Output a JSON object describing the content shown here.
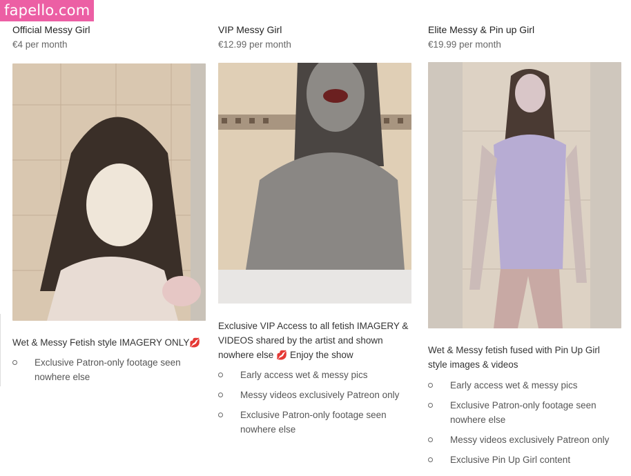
{
  "watermark": "fapello.com",
  "tiers": [
    {
      "name": "Official Messy Girl",
      "price": "€4 per month",
      "description": "Wet & Messy Fetish style IMAGERY ONLY",
      "description_emoji": "💋",
      "benefits": [
        "Exclusive Patron-only footage seen nowhere else"
      ]
    },
    {
      "name": "VIP Messy Girl",
      "price": "€12.99 per month",
      "description_a": "Exclusive VIP Access to all fetish IMAGERY & VIDEOS shared by the artist and shown nowhere else",
      "description_emoji": "💋",
      "description_b": "Enjoy the show",
      "benefits": [
        "Early access wet & messy pics",
        "Messy videos exclusively Patreon only",
        "Exclusive Patron-only footage seen nowhere else"
      ]
    },
    {
      "name": "Elite Messy & Pin up Girl",
      "price": "€19.99 per month",
      "description": "Wet & Messy fetish fused with Pin Up Girl style images & videos",
      "benefits": [
        "Early access wet & messy pics",
        "Exclusive Patron-only footage seen nowhere else",
        "Messy videos exclusively Patreon only",
        "Exclusive Pin Up Girl content"
      ]
    }
  ]
}
